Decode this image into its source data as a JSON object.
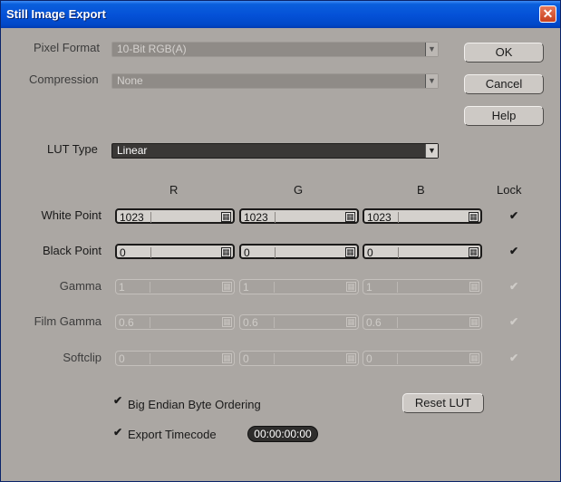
{
  "window": {
    "title": "Still Image Export"
  },
  "labels": {
    "pixel_format": "Pixel Format",
    "compression": "Compression",
    "lut_type": "LUT Type"
  },
  "combos": {
    "pixel_format_value": "10-Bit RGB(A)",
    "compression_value": "None",
    "lut_type_value": "Linear"
  },
  "buttons": {
    "ok": "OK",
    "cancel": "Cancel",
    "help": "Help",
    "reset_lut": "Reset LUT"
  },
  "columns": {
    "r": "R",
    "g": "G",
    "b": "B",
    "lock": "Lock"
  },
  "rows": [
    {
      "label": "White Point",
      "r": "1023",
      "g": "1023",
      "b": "1023",
      "enabled": true,
      "lock": true
    },
    {
      "label": "Black Point",
      "r": "0",
      "g": "0",
      "b": "0",
      "enabled": true,
      "lock": true
    },
    {
      "label": "Gamma",
      "r": "1",
      "g": "1",
      "b": "1",
      "enabled": false,
      "lock": true
    },
    {
      "label": "Film Gamma",
      "r": "0.6",
      "g": "0.6",
      "b": "0.6",
      "enabled": false,
      "lock": true
    },
    {
      "label": "Softclip",
      "r": "0",
      "g": "0",
      "b": "0",
      "enabled": false,
      "lock": true
    }
  ],
  "options": {
    "big_endian_label": "Big Endian Byte Ordering",
    "big_endian_checked": true,
    "export_timecode_label": "Export Timecode",
    "export_timecode_checked": true,
    "timecode_value": "00:00:00:00"
  }
}
